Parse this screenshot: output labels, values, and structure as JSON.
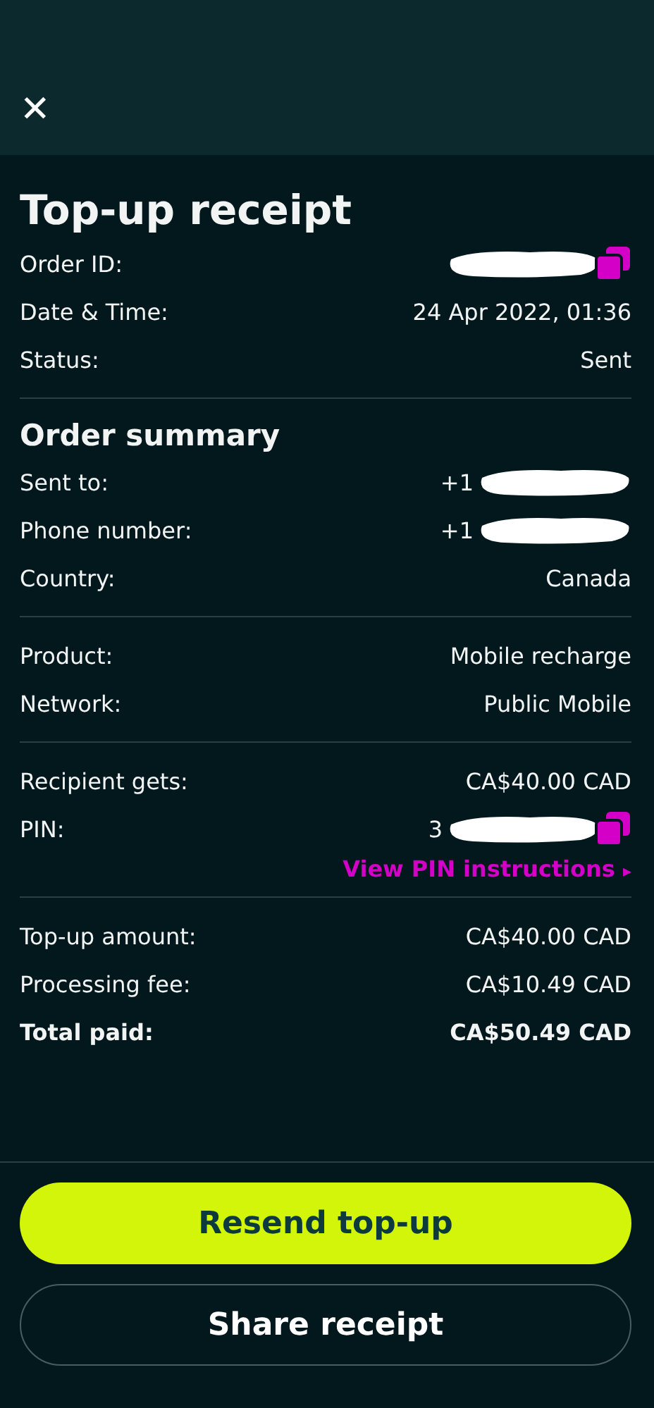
{
  "close": "✕",
  "title": "Top-up receipt",
  "sections": [
    {
      "rows": [
        {
          "label": "Order ID:",
          "redacted": true,
          "copy": true
        },
        {
          "label": "Date & Time:",
          "value": "24 Apr 2022, 01:36"
        },
        {
          "label": "Status:",
          "value": "Sent"
        }
      ]
    },
    {
      "heading": "Order summary",
      "rows": [
        {
          "label": "Sent to:",
          "value": "+1",
          "redacted": true
        },
        {
          "label": "Phone number:",
          "value": "+1",
          "redacted": true
        },
        {
          "label": "Country:",
          "value": "Canada"
        }
      ]
    },
    {
      "rows": [
        {
          "label": "Product:",
          "value": "Mobile recharge"
        },
        {
          "label": "Network:",
          "value": "Public Mobile"
        }
      ]
    },
    {
      "rows": [
        {
          "label": "Recipient gets:",
          "value": "CA$40.00 CAD"
        },
        {
          "label": "PIN:",
          "value": "3",
          "redacted": true,
          "copy": true
        }
      ],
      "link": {
        "text": "View PIN instructions",
        "arrow": "▸"
      }
    },
    {
      "rows": [
        {
          "label": "Top-up amount:",
          "value": "CA$40.00 CAD"
        },
        {
          "label": "Processing fee:",
          "value": "CA$10.49 CAD"
        },
        {
          "label": "Total paid:",
          "value": "CA$50.49 CAD",
          "bold": true
        }
      ]
    }
  ],
  "buttons": [
    {
      "label": "Resend top-up",
      "kind": "primary"
    },
    {
      "label": "Share receipt",
      "kind": "secondary"
    }
  ]
}
